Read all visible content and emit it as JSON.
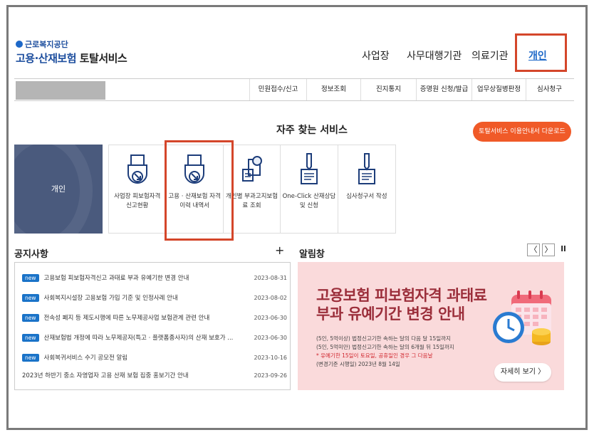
{
  "header": {
    "org_name": "근로복지공단",
    "title_main": "고용·산재보험",
    "title_sub": "토탈서비스",
    "nav": [
      "사업장",
      "사무대행기관",
      "의료기관",
      "개인"
    ]
  },
  "menu": [
    "민원접수/신고",
    "정보조회",
    "진지통지",
    "증명원 신청/발급",
    "업무상질병판정",
    "심사청구"
  ],
  "services": {
    "title": "자주 찾는 서비스",
    "download_label": "토탈서비스 이용안내서 다운로드",
    "personal_label": "개인",
    "tiles": [
      {
        "label": "사업장 피보험자격 신고현황",
        "icon": "document-arrow-icon"
      },
      {
        "label": "고용 · 산재보험 자격 이력 내역서",
        "icon": "document-arrow-icon"
      },
      {
        "label": "개인별 부과고지보험료 조회",
        "icon": "document-search-icon"
      },
      {
        "label": "One-Click 산재상담 및 신청",
        "icon": "pen-document-icon"
      },
      {
        "label": "심사청구서 작성",
        "icon": "pen-document-icon"
      }
    ]
  },
  "notices": {
    "title": "공지사항",
    "more": "+",
    "items": [
      {
        "badge": "new",
        "text": "고용보험 피보험자격신고 과태료 부과 유예기한 변경 안내",
        "date": "2023-08-31"
      },
      {
        "badge": "new",
        "text": "사회복지시설장 고용보험 가입 기준 및 인정사례 안내",
        "date": "2023-08-02"
      },
      {
        "badge": "new",
        "text": "전속성 폐지 등 제도시행에 따른 노무제공사업 보험관계 관련 안내",
        "date": "2023-06-30"
      },
      {
        "badge": "new",
        "text": "산재보험법 개정에 따라 노무제공자(특고 · 플랫폼종사자)의 산재 보호가 ...",
        "date": "2023-06-30"
      },
      {
        "badge": "new",
        "text": "사회복귀서비스 수기 공모전 알림",
        "date": "2023-10-16"
      },
      {
        "badge": "",
        "text": "2023년 하반기 중소 자영업자 고용 산재 보험 집중 홍보기간 안내",
        "date": "2023-09-26"
      }
    ]
  },
  "notification": {
    "title": "알림창",
    "controls": [
      "〈",
      "〉",
      "ll"
    ],
    "banner": {
      "headline1": "고용보험 피보험자격 과태료",
      "headline2": "부과 유예기간 변경 안내",
      "line1": "(5인, 5억이상) 법정신고기한 속하는 달의 다음 달 15일까지",
      "line2": "(5인, 5억미만) 법정신고기한 속하는 달의 6개월 뒤 15일까지",
      "line3": "* 유예기한 15일이 토요일, 공휴일인 경우 그 다음날",
      "line4": "(변경기준 시행일) 2023년 8월 14일",
      "button": "자세히 보기  〉"
    }
  },
  "colors": {
    "accent": "#1d68c8",
    "highlight_box": "#d4462a",
    "download_btn": "#f05a28",
    "banner_bg": "#fadadb",
    "personal_card": "#4a5a7d"
  }
}
